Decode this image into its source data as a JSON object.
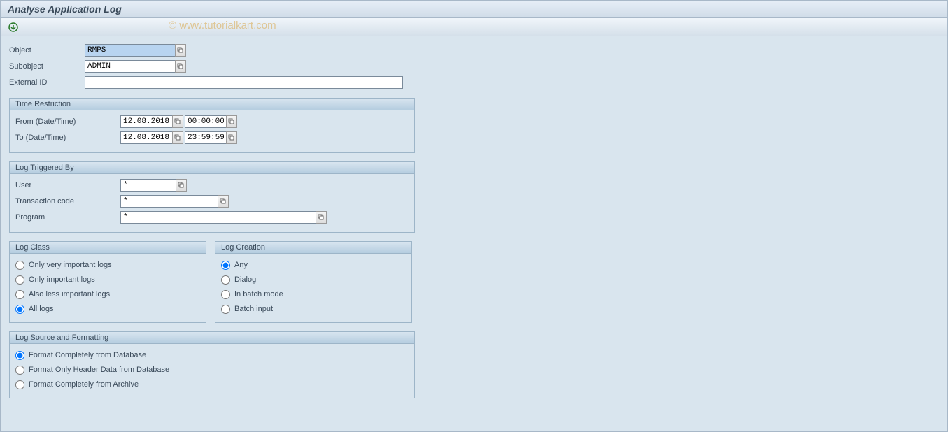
{
  "page": {
    "title": "Analyse Application Log"
  },
  "watermark": "© www.tutorialkart.com",
  "top": {
    "object_label": "Object",
    "object_value": "RMPS",
    "subobject_label": "Subobject",
    "subobject_value": "ADMIN",
    "external_id_label": "External ID",
    "external_id_value": ""
  },
  "time_restriction": {
    "title": "Time Restriction",
    "from_label": "From (Date/Time)",
    "from_date": "12.08.2018",
    "from_time": "00:00:00",
    "to_label": "To (Date/Time)",
    "to_date": "12.08.2018",
    "to_time": "23:59:59"
  },
  "log_triggered": {
    "title": "Log Triggered By",
    "user_label": "User",
    "user_value": "*",
    "tcode_label": "Transaction code",
    "tcode_value": "*",
    "program_label": "Program",
    "program_value": "*"
  },
  "log_class": {
    "title": "Log Class",
    "opt1": "Only very important logs",
    "opt2": "Only important logs",
    "opt3": "Also less important logs",
    "opt4": "All logs"
  },
  "log_creation": {
    "title": "Log Creation",
    "opt1": "Any",
    "opt2": "Dialog",
    "opt3": "In batch mode",
    "opt4": "Batch input"
  },
  "log_source": {
    "title": "Log Source and Formatting",
    "opt1": "Format Completely from Database",
    "opt2": "Format Only Header Data from Database",
    "opt3": "Format Completely from Archive"
  }
}
